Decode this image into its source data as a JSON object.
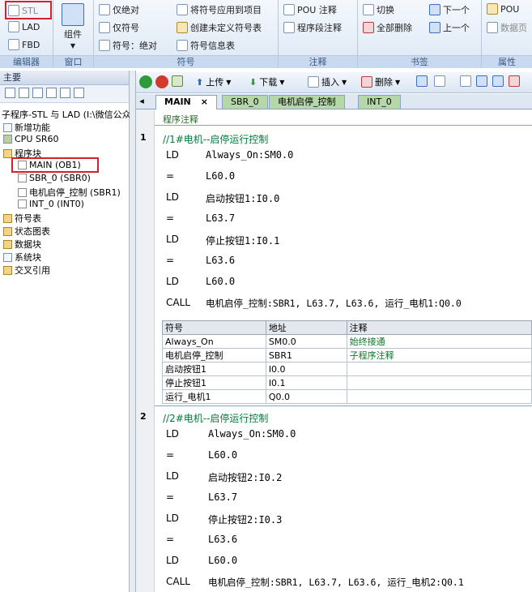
{
  "ribbon": {
    "editor_group": {
      "stl": "STL",
      "lad": "LAD",
      "fbd": "FBD",
      "label": "编辑器"
    },
    "window_group": {
      "component": "组件",
      "label": "窗口"
    },
    "symbol_group": {
      "abs_only": "仅绝对",
      "sym_only": "仅符号",
      "sym_abs": "符号：绝对",
      "apply_project": "将符号应用到项目",
      "create_undefined": "创建未定义符号表",
      "symbol_info": "符号信息表",
      "label": "符号"
    },
    "comment_group": {
      "pou_comment": "POU 注释",
      "segment_comment": "程序段注释",
      "label": "注释"
    },
    "bookmark_group": {
      "toggle": "切换",
      "delete_all": "全部删除",
      "next": "下一个",
      "prev": "上一个",
      "label": "书签"
    },
    "property_group": {
      "pou": "POU",
      "data_page": "数据页",
      "label": "属性"
    }
  },
  "left_pane": {
    "title": "主要",
    "project": "子程序-STL 与 LAD (I:\\微信公众",
    "items": [
      "新增功能",
      "CPU SR60",
      "程序块",
      "MAIN (OB1)",
      "SBR_0 (SBR0)",
      "电机启停_控制 (SBR1)",
      "INT_0 (INT0)",
      "符号表",
      "状态图表",
      "数据块",
      "系统块",
      "交叉引用"
    ]
  },
  "toolbar": {
    "upload": "上传",
    "download": "下载",
    "insert": "插入",
    "delete": "删除"
  },
  "tabs": [
    "MAIN",
    "SBR_0",
    "电机启停_控制",
    "INT_0"
  ],
  "editor": {
    "program_comment": "程序注释",
    "networks": [
      {
        "num": "1",
        "comment": "//1#电机--启停运行控制",
        "lines": [
          [
            "LD",
            "Always_On:SM0.0"
          ],
          [
            "=",
            "L60.0"
          ],
          [
            "LD",
            "启动按钮1:I0.0"
          ],
          [
            "=",
            "L63.7"
          ],
          [
            "LD",
            "停止按钮1:I0.1"
          ],
          [
            "=",
            "L63.6"
          ],
          [
            "LD",
            "L60.0"
          ],
          [
            "CALL",
            "电机启停_控制:SBR1, L63.7, L63.6, 运行_电机1:Q0.0"
          ]
        ]
      },
      {
        "num": "2",
        "comment": "//2#电机--启停运行控制",
        "lines": [
          [
            "LD",
            "Always_On:SM0.0"
          ],
          [
            "=",
            "L60.0"
          ],
          [
            "LD",
            "启动按钮2:I0.2"
          ],
          [
            "=",
            "L63.7"
          ],
          [
            "LD",
            "停止按钮2:I0.3"
          ],
          [
            "=",
            "L63.6"
          ],
          [
            "LD",
            "L60.0"
          ],
          [
            "CALL",
            "电机启停_控制:SBR1, L63.7, L63.6, 运行_电机2:Q0.1"
          ]
        ]
      }
    ],
    "symbol_table": {
      "headers": [
        "符号",
        "地址",
        "注释"
      ],
      "rows": [
        [
          "Always_On",
          "SM0.0",
          "始终接通"
        ],
        [
          "电机启停_控制",
          "SBR1",
          "子程序注释"
        ],
        [
          "启动按钮1",
          "I0.0",
          ""
        ],
        [
          "停止按钮1",
          "I0.1",
          ""
        ],
        [
          "运行_电机1",
          "Q0.0",
          ""
        ]
      ]
    }
  }
}
